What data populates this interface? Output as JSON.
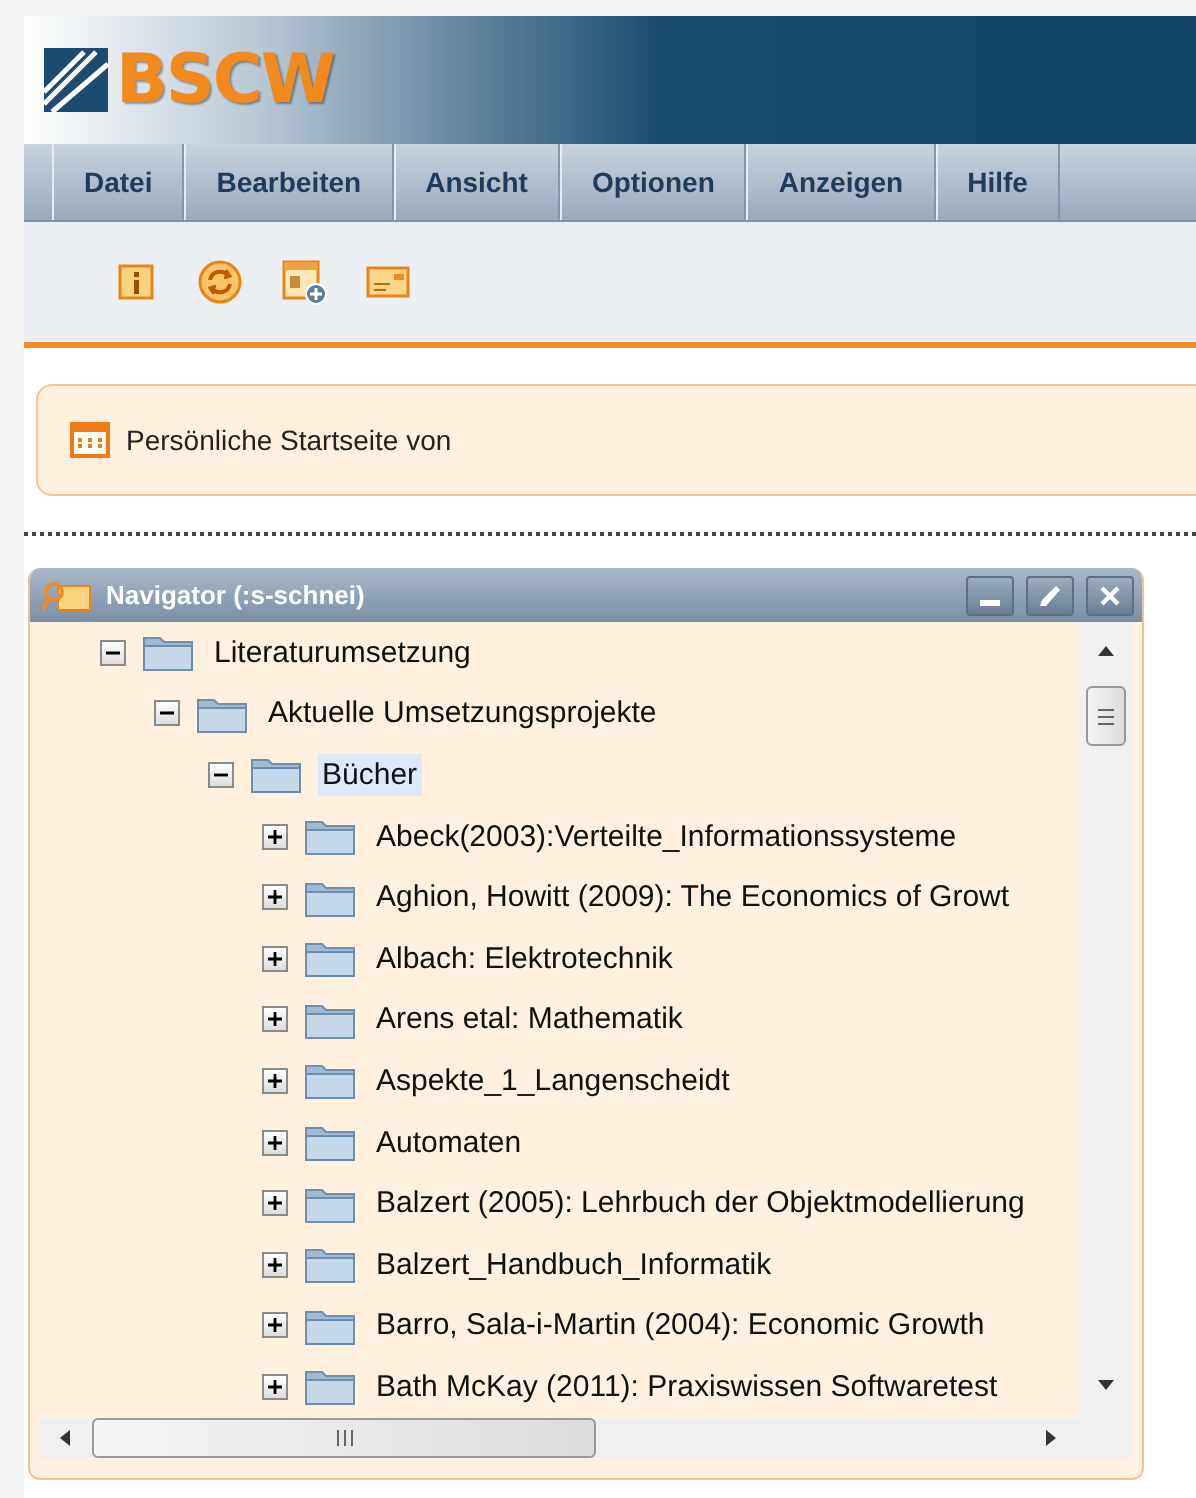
{
  "header": {
    "logo": "BSCW"
  },
  "menu": [
    {
      "label": "Datei"
    },
    {
      "label": "Bearbeiten"
    },
    {
      "label": "Ansicht"
    },
    {
      "label": "Optionen"
    },
    {
      "label": "Anzeigen"
    },
    {
      "label": "Hilfe"
    }
  ],
  "notice": {
    "text": "Persönliche Startseite von"
  },
  "navigator": {
    "title": "Navigator (:s-schnei)",
    "tree": [
      {
        "label": "Literaturumsetzung",
        "expanded": true,
        "selected": false,
        "children": [
          {
            "label": "Aktuelle Umsetzungsprojekte",
            "expanded": true,
            "selected": false,
            "children": [
              {
                "label": "Bücher",
                "expanded": true,
                "selected": true,
                "children": [
                  {
                    "label": "Abeck(2003):Verteilte_Informationssysteme",
                    "expanded": false,
                    "selected": false
                  },
                  {
                    "label": "Aghion, Howitt (2009): The Economics of Growt",
                    "expanded": false,
                    "selected": false
                  },
                  {
                    "label": "Albach: Elektrotechnik",
                    "expanded": false,
                    "selected": false
                  },
                  {
                    "label": "Arens etal: Mathematik",
                    "expanded": false,
                    "selected": false
                  },
                  {
                    "label": "Aspekte_1_Langenscheidt",
                    "expanded": false,
                    "selected": false
                  },
                  {
                    "label": "Automaten",
                    "expanded": false,
                    "selected": false
                  },
                  {
                    "label": "Balzert (2005): Lehrbuch der Objektmodellierung",
                    "expanded": false,
                    "selected": false
                  },
                  {
                    "label": "Balzert_Handbuch_Informatik",
                    "expanded": false,
                    "selected": false
                  },
                  {
                    "label": "Barro, Sala-i-Martin (2004): Economic Growth",
                    "expanded": false,
                    "selected": false
                  },
                  {
                    "label": "Bath McKay (2011): Praxiswissen Softwaretest",
                    "expanded": false,
                    "selected": false
                  }
                ]
              }
            ]
          }
        ]
      }
    ]
  }
}
